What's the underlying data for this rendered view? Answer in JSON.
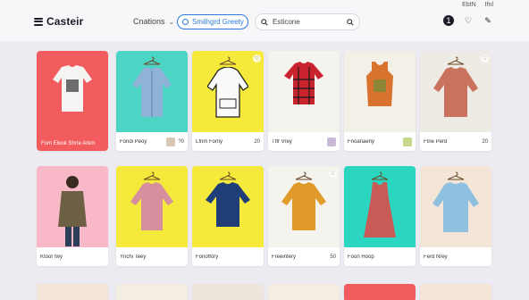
{
  "header": {
    "brand": "Casteir",
    "category_label": "Cnations",
    "pill_label": "Smilhgrd Greety",
    "search_text": "Esticone",
    "top_right_texts": [
      "EbtN",
      "Ifnl"
    ]
  },
  "colors": {
    "accent": "#2d7be0",
    "page_bg": "#ecebf1"
  },
  "row1": [
    {
      "label": "Fom Elook Shrre Arkm",
      "bg": "#f25c5f"
    },
    {
      "label": "Fondi Peoy",
      "num": "?0",
      "bg": "#4cd4c4"
    },
    {
      "label": "Lfnm Fomy",
      "num": "20",
      "bg": "#f5ea3b"
    },
    {
      "label": "Ttfr Vrey",
      "num": "",
      "bg": "#f5f3ee"
    },
    {
      "label": "Fnoanaeny",
      "num": "",
      "bg": "#f3f0e8"
    },
    {
      "label": "Ftne Perd",
      "num": "20",
      "bg": "#eeeae4"
    }
  ],
  "row2": [
    {
      "label": "Ktoor fwy",
      "num": "",
      "bg": "#f9b8c8"
    },
    {
      "label": "Ynchi Teey",
      "num": "",
      "bg": "#f5ea3b"
    },
    {
      "label": "Fonoffory",
      "num": "",
      "bg": "#f5ea3b"
    },
    {
      "label": "Freeinfery",
      "num": "50",
      "bg": "#f5f3ee"
    },
    {
      "label": "Foon Hoop",
      "num": "",
      "bg": "#2bd6c0"
    },
    {
      "label": "Ferd Nrey",
      "num": "",
      "bg": "#f3e6d8"
    }
  ]
}
